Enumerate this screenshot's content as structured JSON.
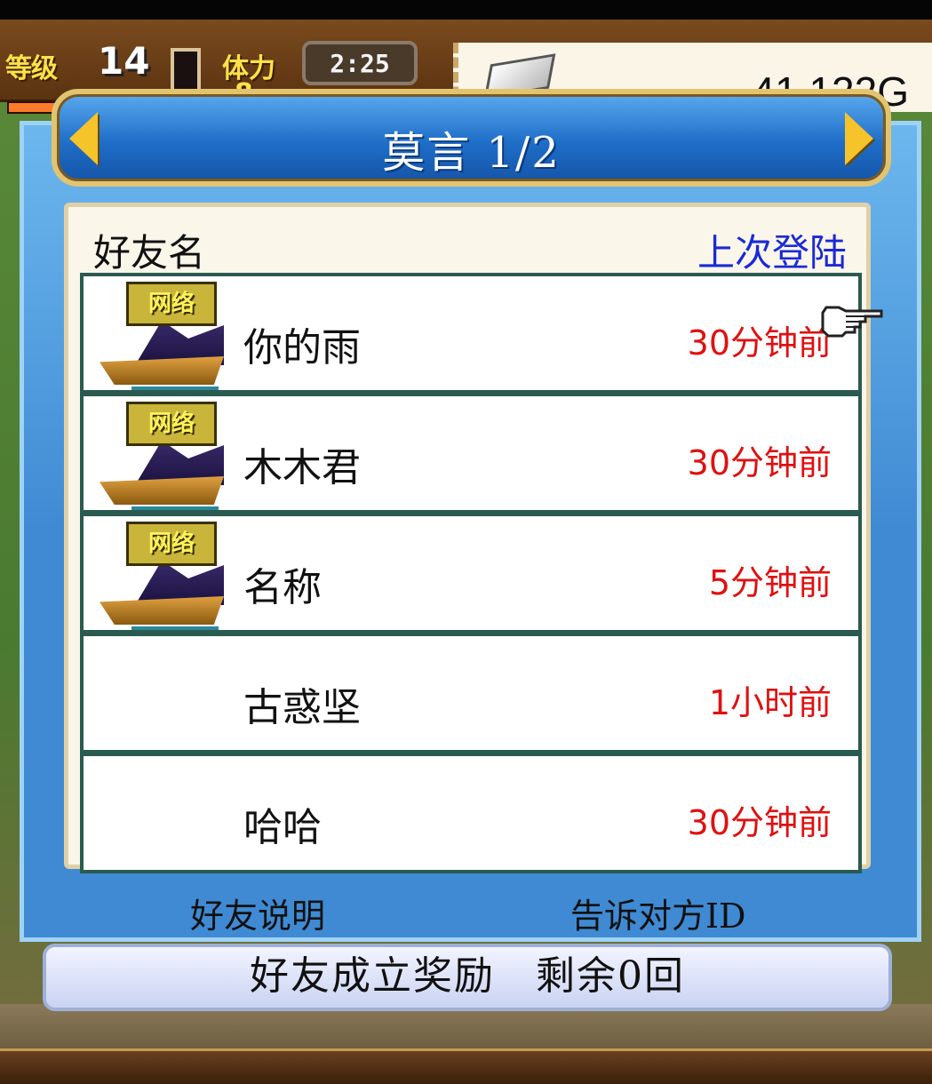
{
  "hud": {
    "level_label": "等级",
    "level_value": "14",
    "xp_progress": 0.55,
    "stamina_label": "体力",
    "stamina_value": "8",
    "stamina_fraction": 0.28,
    "timer": "2:25",
    "gold": "41.122G"
  },
  "dialog": {
    "title": "莫言 1/2",
    "columns": {
      "name": "好友名",
      "last_login": "上次登陆"
    },
    "rows": [
      {
        "tag": "网络",
        "name": "你的雨",
        "time": "30分钟前",
        "has_avatar": true
      },
      {
        "tag": "网络",
        "name": "木木君",
        "time": "30分钟前",
        "has_avatar": true
      },
      {
        "tag": "网络",
        "name": "名称",
        "time": "5分钟前",
        "has_avatar": true
      },
      {
        "name": "古惑坚",
        "time": "1小时前",
        "has_avatar": false
      },
      {
        "name": "哈哈",
        "time": "30分钟前",
        "has_avatar": false
      }
    ],
    "footer_left": "好友说明",
    "footer_right": "告诉对方ID",
    "reward": "好友成立奖励　剩余0回"
  },
  "colors": {
    "accent_gold": "#f5c32a",
    "time_red": "#e01010",
    "header_blue": "#1a2ad6"
  },
  "icons": [
    "arrow-left-icon",
    "arrow-right-icon",
    "pointing-hand-icon",
    "silver-ingot-icon",
    "ship-avatar-icon"
  ]
}
